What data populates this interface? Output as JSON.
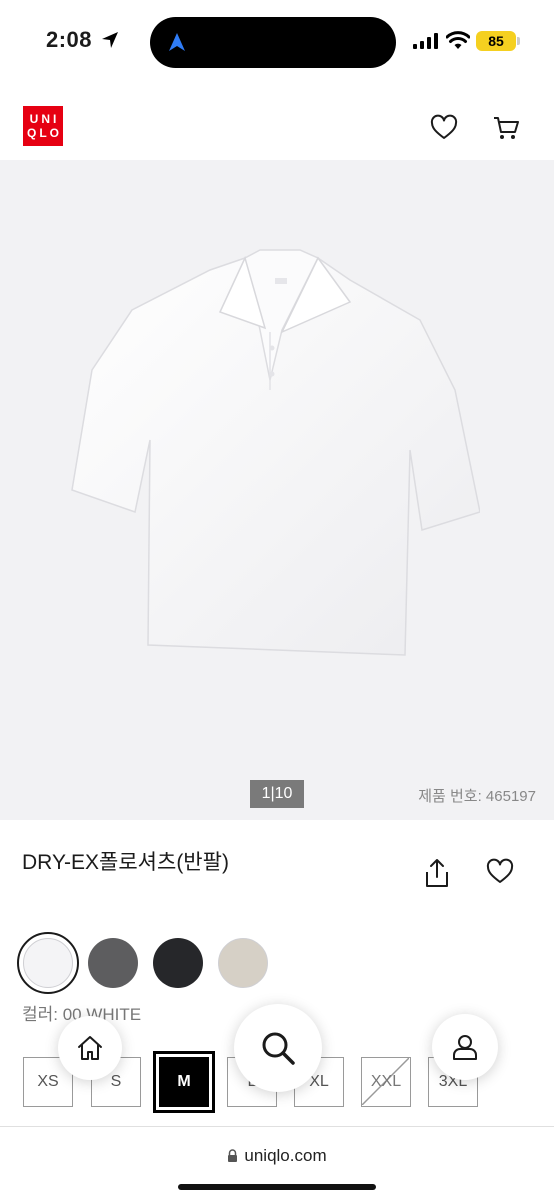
{
  "status": {
    "time": "2:08",
    "battery": "85"
  },
  "header": {
    "logo_line1": "UNI",
    "logo_line2": "QLO"
  },
  "product": {
    "image_counter": "1|10",
    "product_number": "제품 번호: 465197",
    "title": "DRY-EX폴로셔츠(반팔)",
    "color_label": "컬러: 00 WHITE",
    "swatches": [
      {
        "name": "white",
        "color": "#f4f4f6"
      },
      {
        "name": "gray",
        "color": "#5d5d5f"
      },
      {
        "name": "black",
        "color": "#26272a"
      },
      {
        "name": "beige",
        "color": "#d6d0c6"
      }
    ],
    "sizes": [
      "XS",
      "S",
      "M",
      "L",
      "XL",
      "XXL",
      "3XL"
    ],
    "selected_size": "M"
  },
  "browser": {
    "url": "uniqlo.com"
  }
}
